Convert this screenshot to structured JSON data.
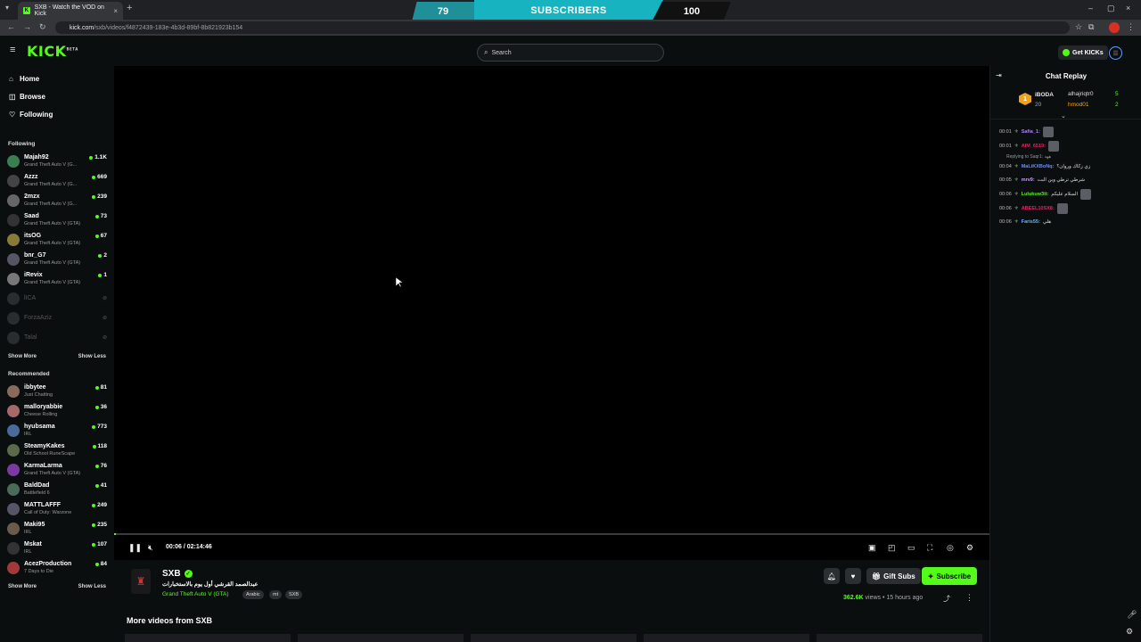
{
  "browser": {
    "tab_title": "SXB - Watch the VOD on Kick",
    "favicon": "K",
    "url_host": "kick.com",
    "url_path": "/sxb/videos/f4872439-183e-4b3d-89bf-8b821923b154"
  },
  "overlay": {
    "left_value": "79",
    "label": "SUBSCRIBERS",
    "right_value": "100"
  },
  "header": {
    "logo": "KICK",
    "logo_suffix": "BETA",
    "search_placeholder": "Search",
    "get_kicks": "Get KICKs"
  },
  "sidebar": {
    "nav": [
      {
        "icon": "⌂",
        "label": "Home"
      },
      {
        "icon": "◫",
        "label": "Browse"
      },
      {
        "icon": "♡",
        "label": "Following"
      }
    ],
    "following_title": "Following",
    "following": [
      {
        "name": "Majah92",
        "game": "Grand Theft Auto V (G...",
        "count": "1.1K",
        "color": "#3a7f52"
      },
      {
        "name": "Azzz",
        "game": "Grand Theft Auto V (G...",
        "count": "669",
        "color": "#444"
      },
      {
        "name": "2mzx",
        "game": "Grand Theft Auto V (G...",
        "count": "239",
        "color": "#666"
      },
      {
        "name": "Saad",
        "game": "Grand Theft Auto V (GTA)",
        "count": "73",
        "color": "#333"
      },
      {
        "name": "itsOG",
        "game": "Grand Theft Auto V (GTA)",
        "count": "67",
        "color": "#8a7a3a"
      },
      {
        "name": "bnr_G7",
        "game": "Grand Theft Auto V (GTA)",
        "count": "2",
        "color": "#556"
      },
      {
        "name": "iRevix",
        "game": "Grand Theft Auto V (GTA)",
        "count": "1",
        "color": "#777"
      }
    ],
    "offline": [
      {
        "name": "lICA"
      },
      {
        "name": "ForzaAziz"
      },
      {
        "name": "Talal"
      }
    ],
    "show_more": "Show More",
    "show_less": "Show Less",
    "recommended_title": "Recommended",
    "recommended": [
      {
        "name": "ibbytee",
        "game": "Just Chatting",
        "count": "81",
        "color": "#8a6a5a"
      },
      {
        "name": "malloryabbie",
        "game": "Cheese Rolling",
        "count": "36",
        "color": "#a46a6a"
      },
      {
        "name": "hyubsama",
        "game": "IRL",
        "count": "773",
        "color": "#4a6a9a"
      },
      {
        "name": "SteamyKakes",
        "game": "Old School RuneScape",
        "count": "118",
        "color": "#5a6a4a"
      },
      {
        "name": "KarmaLarma",
        "game": "Grand Theft Auto V (GTA)",
        "count": "76",
        "color": "#7a3aa0"
      },
      {
        "name": "BaldDad",
        "game": "Battlefield 6",
        "count": "41",
        "color": "#4a6a5a"
      },
      {
        "name": "MATTLAFFF",
        "game": "Call of Duty: Warzone",
        "count": "249",
        "color": "#556"
      },
      {
        "name": "Maki95",
        "game": "IRL",
        "count": "235",
        "color": "#6a5a4a"
      },
      {
        "name": "Mskat",
        "game": "IRL",
        "count": "107",
        "color": "#333"
      },
      {
        "name": "AcezProduction",
        "game": "7 Days to Die",
        "count": "84",
        "color": "#a03a3a"
      }
    ]
  },
  "player": {
    "time": "00:06 / 02:14:46",
    "progress": 0.001
  },
  "channel": {
    "name": "SXB",
    "title": "عبدالصمد القرشي أول يوم بالاستخبارات",
    "category": "Grand Theft Auto V (GTA)",
    "tags": [
      "Arabic",
      "mt",
      "SXB"
    ],
    "gift_subs": "Gift Subs",
    "subscribe": "Subscribe",
    "views": "362.6K",
    "views_label": "views",
    "age": "15 hours ago"
  },
  "more_videos": "More videos from SXB",
  "chat": {
    "title": "Chat Replay",
    "pinned": [
      {
        "name": "iBODA",
        "value": "20",
        "color": "#f0a31d"
      },
      {
        "name": "alhajriqtr0",
        "value": "5",
        "color": "#ddd"
      },
      {
        "name": "hmod01",
        "value": "2",
        "color": "#f0a31d"
      }
    ],
    "reply_text": "Replying to Saqr1: ههه",
    "messages": [
      {
        "time": "00:01",
        "user": "Safia_1:",
        "text": "",
        "color": "#b27cff"
      },
      {
        "time": "00:01",
        "user": "AIM_6519:",
        "text": "",
        "color": "#e0245e"
      },
      {
        "time": "00:04",
        "user": "MaLiKXBoNq:",
        "text": "زي زكاك وروان؟",
        "color": "#6a8cff"
      },
      {
        "time": "00:05",
        "user": "mrv9:",
        "text": "شرطي ترطي وين البت",
        "color": "#c79bff"
      },
      {
        "time": "00:06",
        "user": "Lulukuw3it:",
        "text": "السلام عليكم",
        "color": "#53fc18"
      },
      {
        "time": "00:06",
        "user": "ABEEL10SX8:",
        "text": "",
        "color": "#e0245e"
      },
      {
        "time": "00:06",
        "user": "Faris55:",
        "text": "هلي",
        "color": "#6ab0ff"
      }
    ]
  }
}
